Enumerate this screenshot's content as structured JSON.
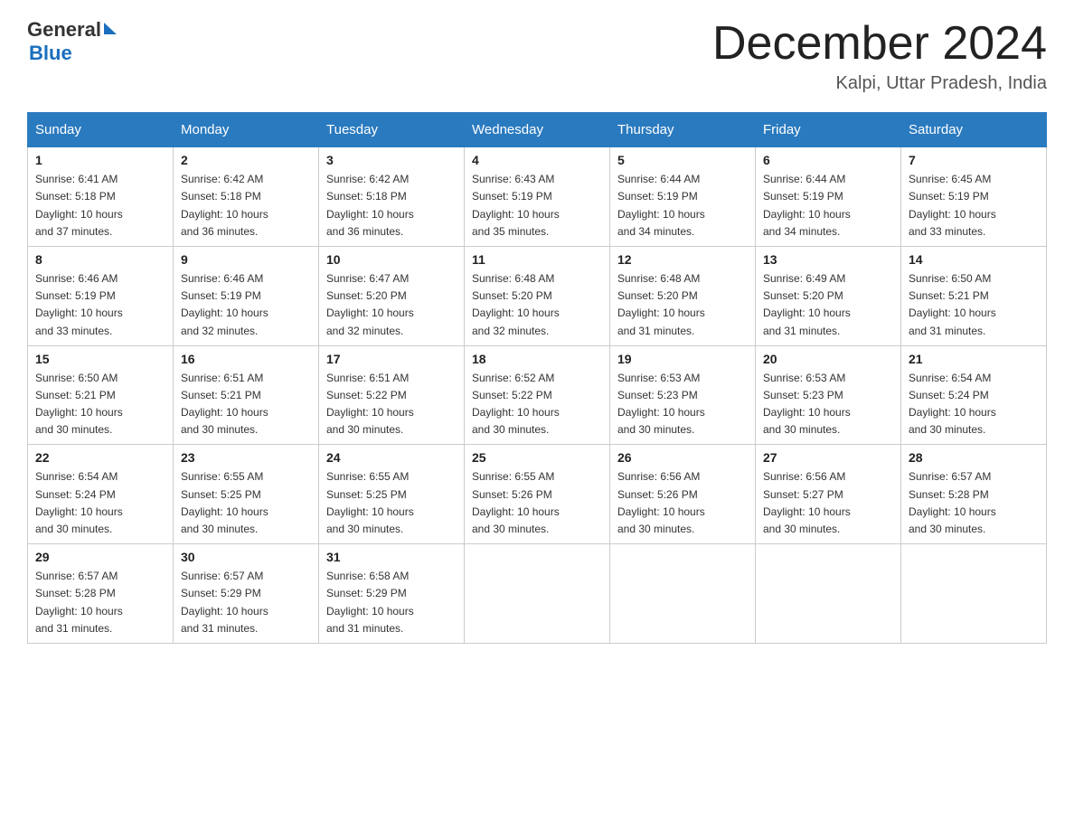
{
  "header": {
    "logo": {
      "general": "General",
      "blue": "Blue"
    },
    "month": "December 2024",
    "location": "Kalpi, Uttar Pradesh, India"
  },
  "days_of_week": [
    "Sunday",
    "Monday",
    "Tuesday",
    "Wednesday",
    "Thursday",
    "Friday",
    "Saturday"
  ],
  "weeks": [
    [
      {
        "day": "1",
        "sunrise": "6:41 AM",
        "sunset": "5:18 PM",
        "daylight": "10 hours and 37 minutes."
      },
      {
        "day": "2",
        "sunrise": "6:42 AM",
        "sunset": "5:18 PM",
        "daylight": "10 hours and 36 minutes."
      },
      {
        "day": "3",
        "sunrise": "6:42 AM",
        "sunset": "5:18 PM",
        "daylight": "10 hours and 36 minutes."
      },
      {
        "day": "4",
        "sunrise": "6:43 AM",
        "sunset": "5:19 PM",
        "daylight": "10 hours and 35 minutes."
      },
      {
        "day": "5",
        "sunrise": "6:44 AM",
        "sunset": "5:19 PM",
        "daylight": "10 hours and 34 minutes."
      },
      {
        "day": "6",
        "sunrise": "6:44 AM",
        "sunset": "5:19 PM",
        "daylight": "10 hours and 34 minutes."
      },
      {
        "day": "7",
        "sunrise": "6:45 AM",
        "sunset": "5:19 PM",
        "daylight": "10 hours and 33 minutes."
      }
    ],
    [
      {
        "day": "8",
        "sunrise": "6:46 AM",
        "sunset": "5:19 PM",
        "daylight": "10 hours and 33 minutes."
      },
      {
        "day": "9",
        "sunrise": "6:46 AM",
        "sunset": "5:19 PM",
        "daylight": "10 hours and 32 minutes."
      },
      {
        "day": "10",
        "sunrise": "6:47 AM",
        "sunset": "5:20 PM",
        "daylight": "10 hours and 32 minutes."
      },
      {
        "day": "11",
        "sunrise": "6:48 AM",
        "sunset": "5:20 PM",
        "daylight": "10 hours and 32 minutes."
      },
      {
        "day": "12",
        "sunrise": "6:48 AM",
        "sunset": "5:20 PM",
        "daylight": "10 hours and 31 minutes."
      },
      {
        "day": "13",
        "sunrise": "6:49 AM",
        "sunset": "5:20 PM",
        "daylight": "10 hours and 31 minutes."
      },
      {
        "day": "14",
        "sunrise": "6:50 AM",
        "sunset": "5:21 PM",
        "daylight": "10 hours and 31 minutes."
      }
    ],
    [
      {
        "day": "15",
        "sunrise": "6:50 AM",
        "sunset": "5:21 PM",
        "daylight": "10 hours and 30 minutes."
      },
      {
        "day": "16",
        "sunrise": "6:51 AM",
        "sunset": "5:21 PM",
        "daylight": "10 hours and 30 minutes."
      },
      {
        "day": "17",
        "sunrise": "6:51 AM",
        "sunset": "5:22 PM",
        "daylight": "10 hours and 30 minutes."
      },
      {
        "day": "18",
        "sunrise": "6:52 AM",
        "sunset": "5:22 PM",
        "daylight": "10 hours and 30 minutes."
      },
      {
        "day": "19",
        "sunrise": "6:53 AM",
        "sunset": "5:23 PM",
        "daylight": "10 hours and 30 minutes."
      },
      {
        "day": "20",
        "sunrise": "6:53 AM",
        "sunset": "5:23 PM",
        "daylight": "10 hours and 30 minutes."
      },
      {
        "day": "21",
        "sunrise": "6:54 AM",
        "sunset": "5:24 PM",
        "daylight": "10 hours and 30 minutes."
      }
    ],
    [
      {
        "day": "22",
        "sunrise": "6:54 AM",
        "sunset": "5:24 PM",
        "daylight": "10 hours and 30 minutes."
      },
      {
        "day": "23",
        "sunrise": "6:55 AM",
        "sunset": "5:25 PM",
        "daylight": "10 hours and 30 minutes."
      },
      {
        "day": "24",
        "sunrise": "6:55 AM",
        "sunset": "5:25 PM",
        "daylight": "10 hours and 30 minutes."
      },
      {
        "day": "25",
        "sunrise": "6:55 AM",
        "sunset": "5:26 PM",
        "daylight": "10 hours and 30 minutes."
      },
      {
        "day": "26",
        "sunrise": "6:56 AM",
        "sunset": "5:26 PM",
        "daylight": "10 hours and 30 minutes."
      },
      {
        "day": "27",
        "sunrise": "6:56 AM",
        "sunset": "5:27 PM",
        "daylight": "10 hours and 30 minutes."
      },
      {
        "day": "28",
        "sunrise": "6:57 AM",
        "sunset": "5:28 PM",
        "daylight": "10 hours and 30 minutes."
      }
    ],
    [
      {
        "day": "29",
        "sunrise": "6:57 AM",
        "sunset": "5:28 PM",
        "daylight": "10 hours and 31 minutes."
      },
      {
        "day": "30",
        "sunrise": "6:57 AM",
        "sunset": "5:29 PM",
        "daylight": "10 hours and 31 minutes."
      },
      {
        "day": "31",
        "sunrise": "6:58 AM",
        "sunset": "5:29 PM",
        "daylight": "10 hours and 31 minutes."
      },
      null,
      null,
      null,
      null
    ]
  ],
  "labels": {
    "sunrise": "Sunrise:",
    "sunset": "Sunset:",
    "daylight": "Daylight:"
  }
}
